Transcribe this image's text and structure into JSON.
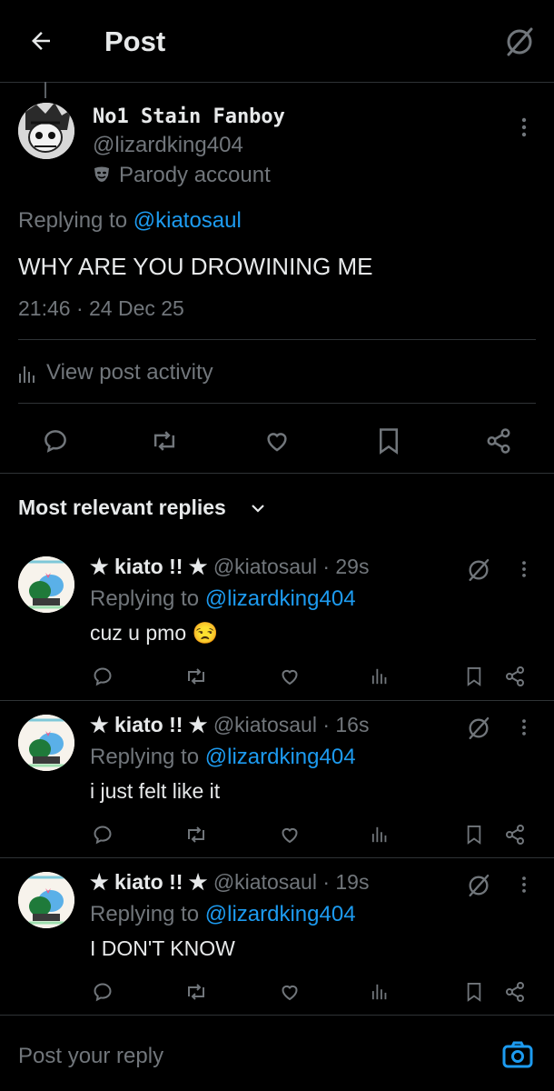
{
  "header": {
    "title": "Post"
  },
  "post": {
    "display_name": "No1 Stain Fanboy",
    "handle": "@lizardking404",
    "parody_label": "Parody account",
    "replying_prefix": "Replying to",
    "replying_to": "@kiatosaul",
    "text": "WHY ARE YOU DROWINING ME",
    "timestamp": "21:46 · 24 Dec 25",
    "activity_label": "View post activity"
  },
  "replies_header": {
    "label": "Most relevant replies"
  },
  "replies": [
    {
      "name": "★ kiato !! ★",
      "handle": "@kiatosaul",
      "time": "· 29s",
      "replying_prefix": "Replying to",
      "replying_to": "@lizardking404",
      "text": "cuz u pmo 😒"
    },
    {
      "name": "★ kiato !! ★",
      "handle": "@kiatosaul",
      "time": "· 16s",
      "replying_prefix": "Replying to",
      "replying_to": "@lizardking404",
      "text": "i just felt like it"
    },
    {
      "name": "★ kiato !! ★",
      "handle": "@kiatosaul",
      "time": "· 19s",
      "replying_prefix": "Replying to",
      "replying_to": "@lizardking404",
      "text": "I DON'T KNOW"
    }
  ],
  "composer": {
    "placeholder": "Post your reply"
  },
  "colors": {
    "background": "#000000",
    "text": "#e7e9ea",
    "muted": "#71767b",
    "link": "#1d9bf0",
    "divider": "#2f3336"
  }
}
